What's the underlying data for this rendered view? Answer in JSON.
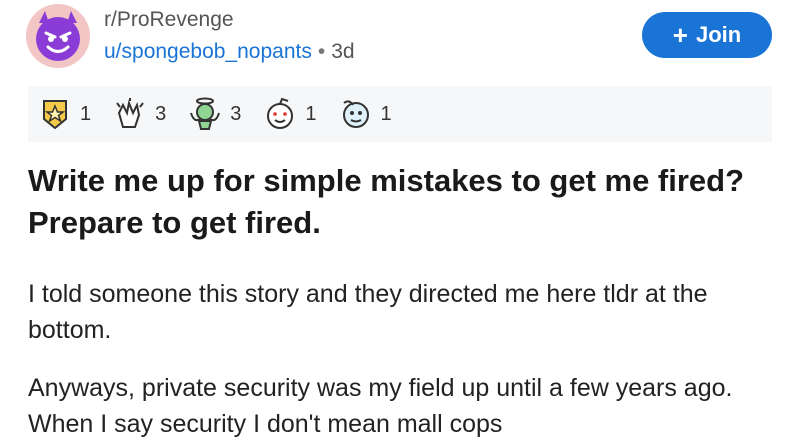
{
  "post": {
    "subreddit": "r/ProRevenge",
    "username": "u/spongebob_nopants",
    "separator": "•",
    "age": "3d",
    "join_label": "Join",
    "join_icon": "plus-icon"
  },
  "awards": [
    {
      "icon": "gold-award-icon",
      "count": "1"
    },
    {
      "icon": "clapping-award-icon",
      "count": "3"
    },
    {
      "icon": "angel-award-icon",
      "count": "3"
    },
    {
      "icon": "wholesome-award-icon",
      "count": "1"
    },
    {
      "icon": "helpful-award-icon",
      "count": "1"
    }
  ],
  "content": {
    "title": "Write me up for simple mistakes to get me fired? Prepare to get fired.",
    "paragraph_1": "I told someone this story and they directed me here tldr at the bottom.",
    "paragraph_2": "Anyways, private security was my field up until a few years ago. When I say security I don't mean mall cops"
  },
  "colors": {
    "accent": "#1a74d6",
    "award_bar_bg": "#f6f7f8",
    "avatar_bg": "#f3c6c6",
    "avatar_face": "#8b3bd6"
  }
}
